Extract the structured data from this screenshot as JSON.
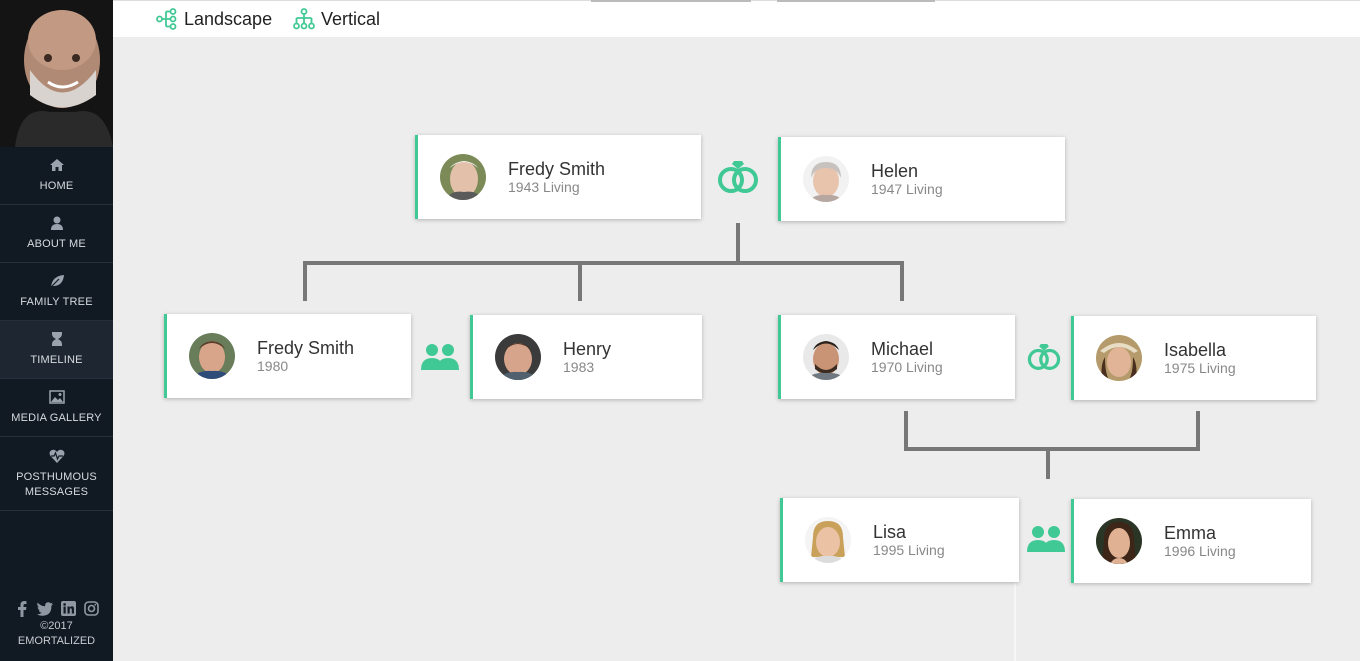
{
  "sidebar": {
    "nav": [
      {
        "label": "HOME",
        "icon": "home-icon"
      },
      {
        "label": "ABOUT ME",
        "icon": "user-icon"
      },
      {
        "label": "FAMILY TREE",
        "icon": "leaf-icon"
      },
      {
        "label": "TIMELINE",
        "icon": "hourglass-icon"
      },
      {
        "label": "MEDIA GALLERY",
        "icon": "image-icon"
      },
      {
        "label": "POSTHUMOUS MESSAGES",
        "icon": "heartbeat-icon"
      }
    ],
    "social": [
      "facebook-icon",
      "twitter-icon",
      "linkedin-icon",
      "instagram-icon"
    ],
    "copyright_year": "©2017",
    "copyright_brand": "EMORTALIZED"
  },
  "topbar": {
    "landscape_label": "Landscape",
    "vertical_label": "Vertical"
  },
  "tree": {
    "people": {
      "fredy_sr": {
        "name": "Fredy Smith",
        "date": "1943 Living"
      },
      "helen": {
        "name": "Helen",
        "date": "1947 Living"
      },
      "fredy_jr": {
        "name": "Fredy Smith",
        "date": "1980"
      },
      "henry": {
        "name": "Henry",
        "date": "1983"
      },
      "michael": {
        "name": "Michael",
        "date": "1970 Living"
      },
      "isabella": {
        "name": "Isabella",
        "date": "1975 Living"
      },
      "lisa": {
        "name": "Lisa",
        "date": "1995 Living"
      },
      "emma": {
        "name": "Emma",
        "date": "1996 Living"
      }
    },
    "relations": [
      "marriage-rings-icon",
      "siblings-icon",
      "marriage-rings-icon",
      "siblings-icon"
    ]
  },
  "colors": {
    "accent": "#41c995",
    "sidebar_bg": "#111923",
    "canvas_bg": "#ededed",
    "connector": "#777777"
  }
}
